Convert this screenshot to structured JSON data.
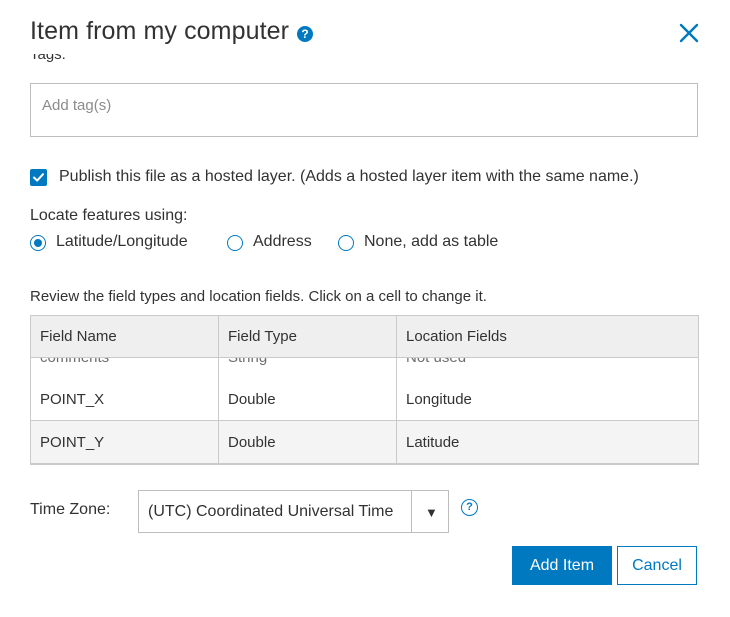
{
  "dialog": {
    "title": "Item from my computer",
    "help_icon": "help-icon",
    "close_icon": "close-icon"
  },
  "tags": {
    "label": "Tags:",
    "placeholder": "Add tag(s)",
    "value": ""
  },
  "publish": {
    "checked": true,
    "label": "Publish this file as a hosted layer. (Adds a hosted layer item with the same name.)"
  },
  "locate": {
    "label": "Locate features using:",
    "options": [
      {
        "label": "Latitude/Longitude",
        "selected": true
      },
      {
        "label": "Address",
        "selected": false
      },
      {
        "label": "None, add as table",
        "selected": false
      }
    ]
  },
  "review": {
    "label": "Review the field types and location fields. Click on a cell to change it."
  },
  "table": {
    "columns": [
      "Field Name",
      "Field Type",
      "Location Fields"
    ],
    "rows": [
      [
        "comments",
        "String",
        "Not used"
      ],
      [
        "POINT_X",
        "Double",
        "Longitude"
      ],
      [
        "POINT_Y",
        "Double",
        "Latitude"
      ]
    ]
  },
  "timezone": {
    "label": "Time Zone:",
    "selected": "(UTC) Coordinated Universal Time",
    "arrow": "▼"
  },
  "buttons": {
    "add": "Add Item",
    "cancel": "Cancel"
  },
  "colors": {
    "accent": "#0079c1",
    "header_bg": "#efefef",
    "border": "#cacaca"
  }
}
